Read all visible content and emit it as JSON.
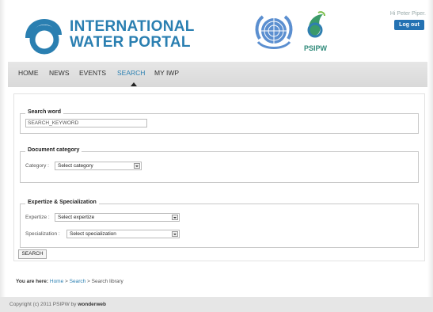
{
  "brand": {
    "line1": "INTERNATIONAL",
    "line2": "WATER PORTAL",
    "partner": "PSIPW",
    "primary_color": "#2a7fb1"
  },
  "user": {
    "greeting": "Hi Peter Piper.",
    "logout_label": "Log out"
  },
  "nav": {
    "items": [
      {
        "label": "HOME"
      },
      {
        "label": "NEWS"
      },
      {
        "label": "EVENTS"
      },
      {
        "label": "SEARCH",
        "active": true
      },
      {
        "label": "MY IWP"
      }
    ]
  },
  "search_word": {
    "legend": "Search word",
    "value": "SEARCH_KEYWORD"
  },
  "document_category": {
    "legend": "Document category",
    "label": "Category :",
    "selected": "Select category"
  },
  "expertise": {
    "legend": "Expertize & Specialization",
    "expertize_label": "Expertize :",
    "expertize_selected": "Select expertize",
    "specialization_label": "Specialization :",
    "specialization_selected": "Select specialization"
  },
  "search_button": "SEARCH",
  "breadcrumb": {
    "lead": "You are here:",
    "home": "Home",
    "sep1": " > ",
    "search": "Search",
    "sep2": " > ",
    "current": "Search library"
  },
  "footer": {
    "copyright": "Copyright (c) 2011 PSIPW by ",
    "author": "wonderweb"
  }
}
